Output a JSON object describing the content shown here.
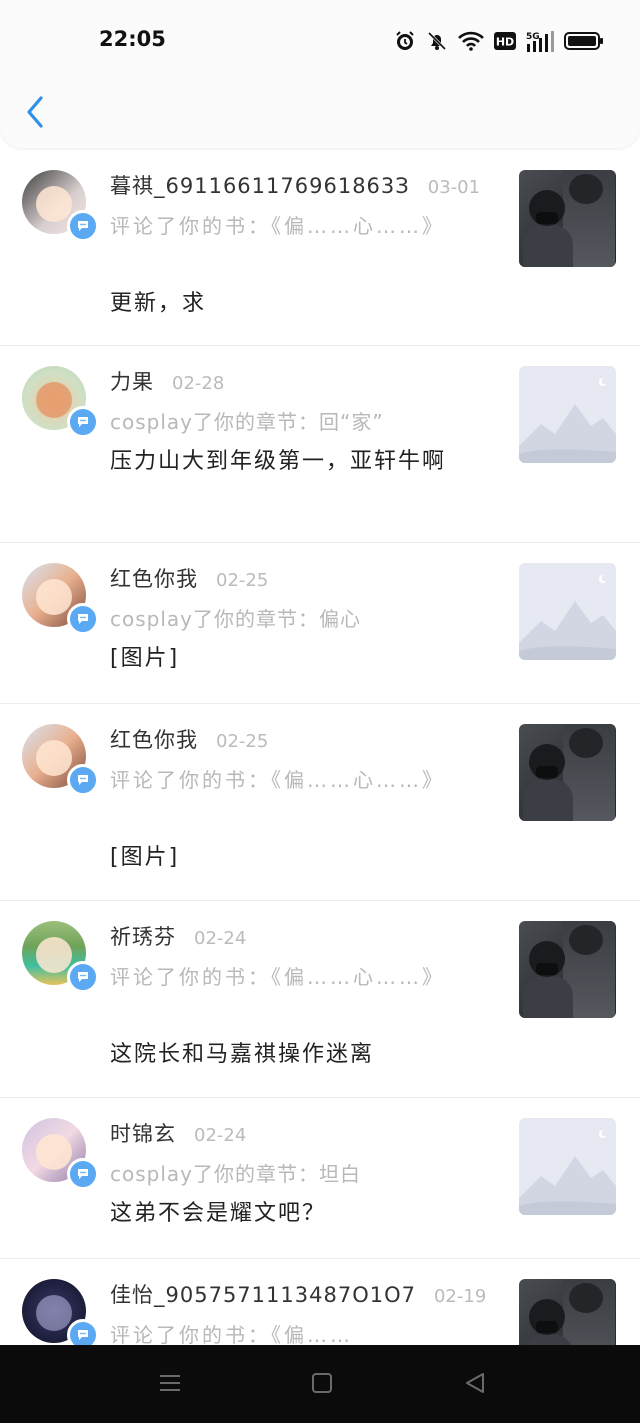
{
  "status": {
    "time": "22:05",
    "icons": [
      "alarm-icon",
      "mute-bell-icon",
      "wifi-icon",
      "hd-icon",
      "5g-signal-icon",
      "battery-icon"
    ]
  },
  "header": {
    "back_icon": "chevron-left-icon"
  },
  "items": [
    {
      "name": "暮祺_6911661176961863З",
      "date": "03-01",
      "action": "评论了你的书：《偏……心……》",
      "comment": "更新，求",
      "thumb": "dark"
    },
    {
      "name": "力果",
      "date": "02-28",
      "action": "cosplay了你的章节：回“家”",
      "comment": "压力山大到年级第一，亚轩牛啊",
      "thumb": "light"
    },
    {
      "name": "红色你我",
      "date": "02-25",
      "action": "cosplay了你的章节：偏心",
      "comment": "[图片]",
      "thumb": "light"
    },
    {
      "name": "红色你我",
      "date": "02-25",
      "action": "评论了你的书：《偏……心……》",
      "comment": "[图片]",
      "thumb": "dark"
    },
    {
      "name": "祈琇芬",
      "date": "02-24",
      "action": "评论了你的书：《偏……心……》",
      "comment": "这院长和马嘉祺操作迷离",
      "thumb": "dark"
    },
    {
      "name": "时锦玄",
      "date": "02-24",
      "action": "cosplay了你的章节：坦白",
      "comment": "这弟不会是耀文吧？",
      "thumb": "light"
    },
    {
      "name": "佳怡_9057571113487О1О7",
      "date": "02-19",
      "action": "评论了你的书：《偏……",
      "comment": "",
      "thumb": "dark"
    }
  ],
  "colors": {
    "accent": "#2f8fe8",
    "badge": "#5aa9f2",
    "meta_gray": "#b8b8b8",
    "navbar": "#0b0b0b"
  },
  "navbar": {
    "icons": [
      "menu-icon",
      "home-square-icon",
      "back-triangle-icon"
    ]
  }
}
